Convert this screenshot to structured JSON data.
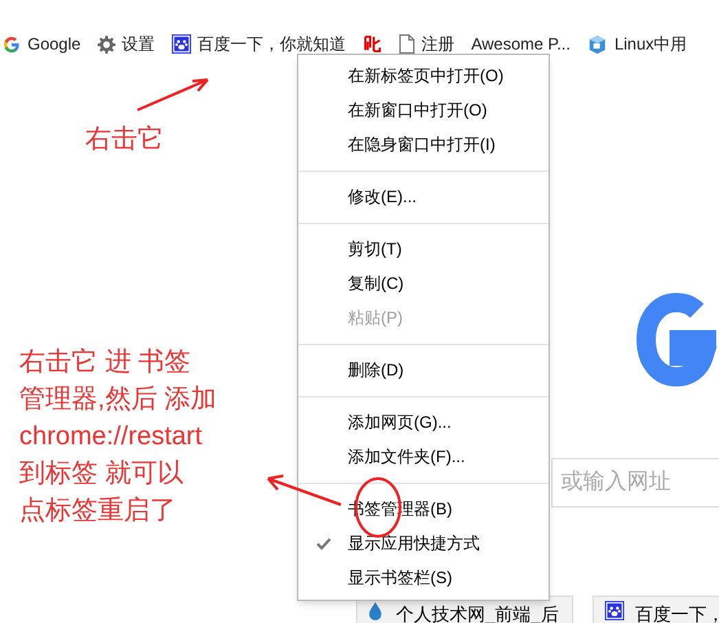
{
  "bookmarks_bar": [
    {
      "kind": "google",
      "label": "Google"
    },
    {
      "kind": "gear",
      "label": "设置"
    },
    {
      "kind": "paw",
      "label": "百度一下，你就知道"
    },
    {
      "kind": "red"
    },
    {
      "kind": "page",
      "label": "注册"
    },
    {
      "kind": "none",
      "label": "Awesome P..."
    },
    {
      "kind": "cube",
      "label": "Linux中用"
    }
  ],
  "context_menu": [
    {
      "kind": "item",
      "label": "在新标签页中打开(O)",
      "disabled": false,
      "checked": false
    },
    {
      "kind": "item",
      "label": "在新窗口中打开(O)",
      "disabled": false,
      "checked": false
    },
    {
      "kind": "item",
      "label": "在隐身窗口中打开(I)",
      "disabled": false,
      "checked": false
    },
    {
      "kind": "separator"
    },
    {
      "kind": "item",
      "label": "修改(E)...",
      "disabled": false,
      "checked": false
    },
    {
      "kind": "separator"
    },
    {
      "kind": "item",
      "label": "剪切(T)",
      "disabled": false,
      "checked": false
    },
    {
      "kind": "item",
      "label": "复制(C)",
      "disabled": false,
      "checked": false
    },
    {
      "kind": "item",
      "label": "粘贴(P)",
      "disabled": true,
      "checked": false
    },
    {
      "kind": "separator"
    },
    {
      "kind": "item",
      "label": "删除(D)",
      "disabled": false,
      "checked": false
    },
    {
      "kind": "separator"
    },
    {
      "kind": "item",
      "label": "添加网页(G)...",
      "disabled": false,
      "checked": false
    },
    {
      "kind": "item",
      "label": "添加文件夹(F)...",
      "disabled": false,
      "checked": false
    },
    {
      "kind": "separator"
    },
    {
      "kind": "item",
      "label": "书签管理器(B)",
      "disabled": false,
      "checked": false
    },
    {
      "kind": "item",
      "label": "显示应用快捷方式",
      "disabled": false,
      "checked": true
    },
    {
      "kind": "item",
      "label": "显示书签栏(S)",
      "disabled": false,
      "checked": false
    }
  ],
  "page": {
    "search_placeholder": "或输入网址",
    "tiles": [
      "个人技术网_前端_后",
      "百度一下，"
    ]
  },
  "annotations": {
    "short_note": "右击它",
    "long_note": [
      "右击它 进 书签",
      "管理器,然后 添加",
      "chrome://restart",
      "到标签 就可以",
      "点标签重启了"
    ]
  }
}
